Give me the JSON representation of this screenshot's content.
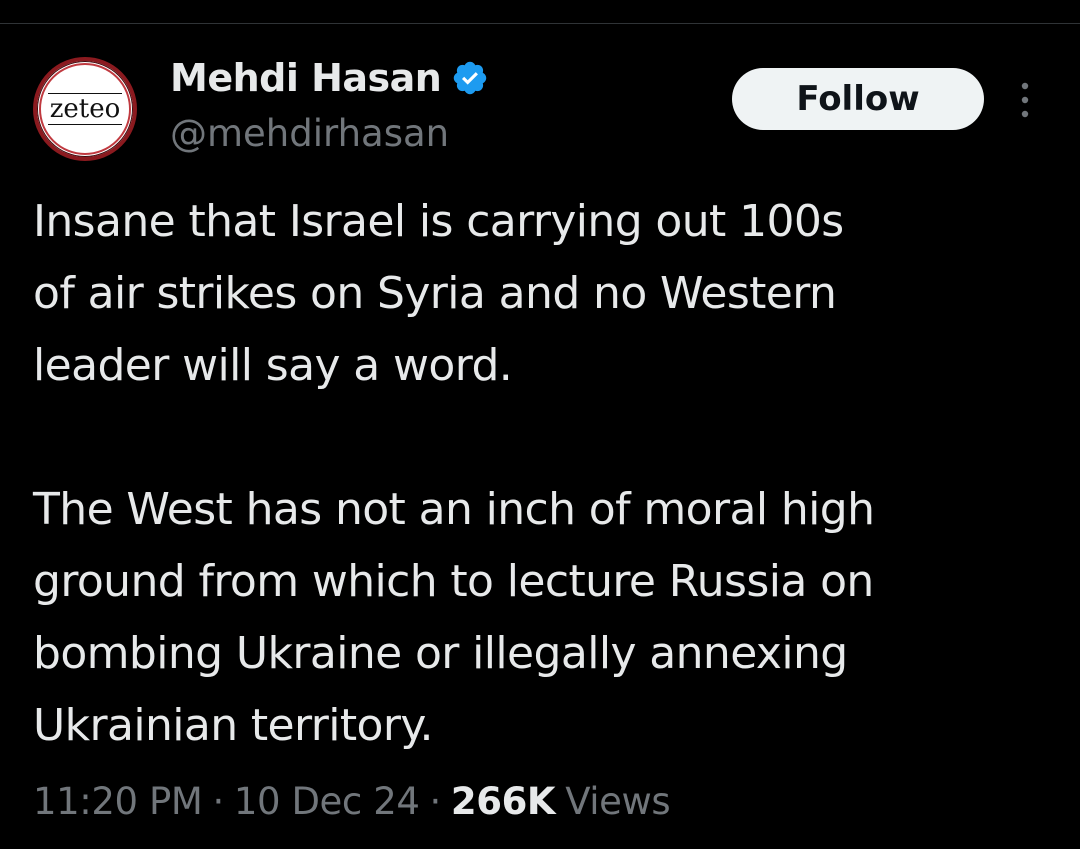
{
  "author": {
    "avatar_text": "zeteo",
    "display_name": "Mehdi Hasan",
    "handle": "@mehdirhasan",
    "verified": true
  },
  "actions": {
    "follow_label": "Follow",
    "more_icon": "more-dots-vertical-icon"
  },
  "tweet": {
    "paragraphs": [
      "Insane that Israel is carrying out 100s\nof air strikes on Syria and no Western\nleader will say a word.",
      "The West has not an inch of moral high\nground from which to lecture Russia on\nbombing Ukraine or illegally annexing\nUkrainian territory."
    ]
  },
  "meta": {
    "time": "11:20 PM",
    "separator": "·",
    "date": "10 Dec 24",
    "views_count": "266K",
    "views_label": "Views"
  },
  "colors": {
    "background": "#000000",
    "text_primary": "#e7e9ea",
    "text_secondary": "#71767b",
    "verified_blue": "#1d9bf0",
    "follow_bg": "#eff3f4",
    "avatar_ring": "#8b1a1f"
  }
}
